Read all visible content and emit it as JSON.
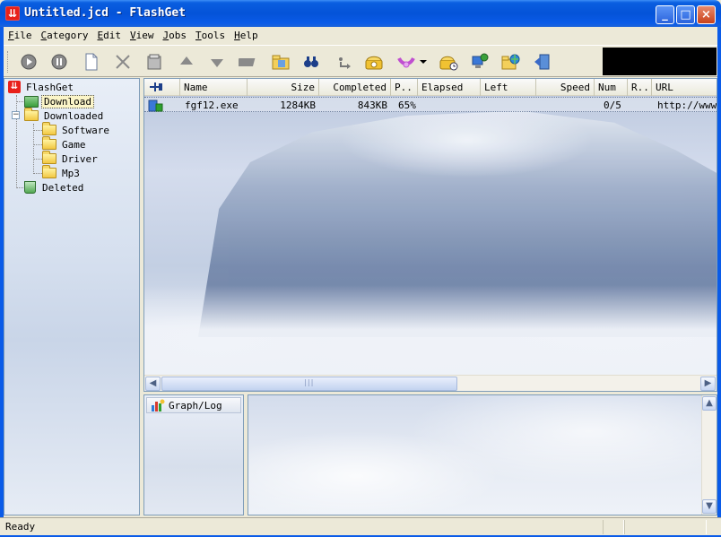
{
  "window": {
    "title": "Untitled.jcd - FlashGet",
    "minimize": "_",
    "maximize": "□",
    "close": "×"
  },
  "menu": [
    "File",
    "Category",
    "Edit",
    "View",
    "Jobs",
    "Tools",
    "Help"
  ],
  "toolbar_icons": [
    "start-icon",
    "pause-icon",
    "new-icon",
    "delete-icon",
    "properties-icon",
    "move-up-icon",
    "move-down-icon",
    "open-folder-icon",
    "find-icon",
    "find-next-icon",
    "dial-icon",
    "hangup-icon",
    "drop-zone-icon",
    "schedule-icon",
    "site-manager-icon",
    "exit-icon"
  ],
  "tree": {
    "root": "FlashGet",
    "download": "Download",
    "downloaded": "Downloaded",
    "children": [
      "Software",
      "Game",
      "Driver",
      "Mp3"
    ],
    "deleted": "Deleted"
  },
  "list": {
    "columns": [
      "Name",
      "Size",
      "Completed",
      "P..",
      "Elapsed",
      "Left",
      "Speed",
      "Num",
      "R..",
      "URL"
    ],
    "rows": [
      {
        "name": "fgf12.exe",
        "size": "1284KB",
        "completed": "843KB",
        "percent": "65%",
        "elapsed": "",
        "left": "",
        "speed": "",
        "num": "0/5",
        "retry": "",
        "url": "http://www."
      }
    ]
  },
  "bottom": {
    "tab": "Graph/Log"
  },
  "status": {
    "text": "Ready"
  },
  "colors": {
    "titlebar": "#0453d8",
    "selection": "#fbf5c8",
    "border": "#7f9db9"
  }
}
